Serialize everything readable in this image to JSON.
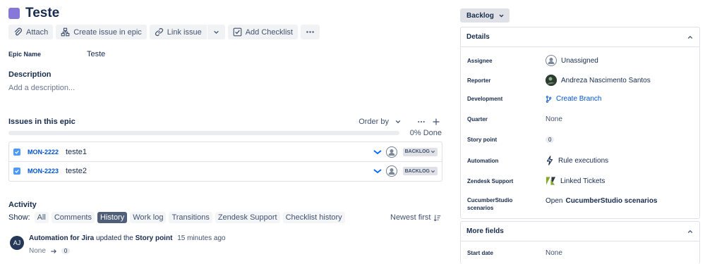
{
  "issue": {
    "title": "Teste",
    "epic_color": "#8777d9"
  },
  "toolbar": {
    "attach": "Attach",
    "create_issue_in_epic": "Create issue in epic",
    "link_issue": "Link issue",
    "add_checklist": "Add Checklist"
  },
  "epic_name": {
    "label": "Epic Name",
    "value": "Teste"
  },
  "description": {
    "heading": "Description",
    "placeholder": "Add a description..."
  },
  "issues_in_epic": {
    "title": "Issues in this epic",
    "order_by": "Order by",
    "progress_percent": 0,
    "progress_label": "0% Done",
    "rows": [
      {
        "key": "MON-2222",
        "summary": "teste1",
        "status": "BACKLOG"
      },
      {
        "key": "MON-2223",
        "summary": "teste2",
        "status": "BACKLOG"
      }
    ]
  },
  "activity": {
    "title": "Activity",
    "show_label": "Show:",
    "filters": [
      "All",
      "Comments",
      "History",
      "Work log",
      "Transitions",
      "Zendesk Support",
      "Checklist history"
    ],
    "active_filter": "History",
    "sort": "Newest first",
    "item": {
      "avatar_initials": "AJ",
      "actor": "Automation for Jira",
      "action": "updated the",
      "field": "Story point",
      "time": "15 minutes ago",
      "from": "None",
      "to": "0"
    }
  },
  "status_button": "Backlog",
  "details": {
    "heading": "Details",
    "assignee": {
      "label": "Assignee",
      "value": "Unassigned"
    },
    "reporter": {
      "label": "Reporter",
      "value": "Andreza Nascimento Santos"
    },
    "development": {
      "label": "Development",
      "value": "Create Branch"
    },
    "quarter": {
      "label": "Quarter",
      "value": "None"
    },
    "story_point": {
      "label": "Story point",
      "value": "0"
    },
    "automation": {
      "label": "Automation",
      "value": "Rule executions"
    },
    "zendesk": {
      "label": "Zendesk Support",
      "value": "Linked Tickets"
    },
    "cucumber": {
      "label_line1": "CucumberStudio",
      "label_line2": "scenarios",
      "value_prefix": "Open",
      "value_bold": "CucumberStudio scenarios"
    }
  },
  "more_fields": {
    "heading": "More fields",
    "start_date": {
      "label": "Start date",
      "value": "None"
    }
  },
  "colors": {
    "link": "#0052cc",
    "text": "#172b4d",
    "active_filter_bg": "#505f79",
    "check_blue": "#4c9aff"
  }
}
